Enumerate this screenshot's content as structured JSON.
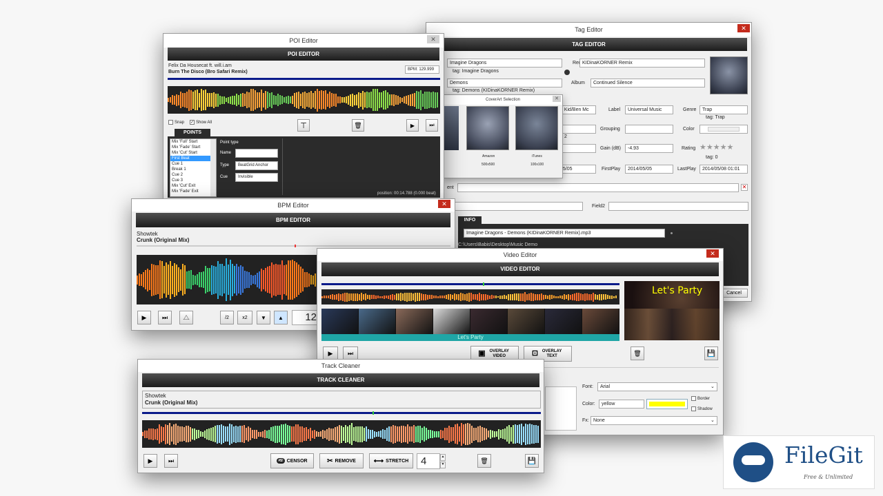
{
  "tag_editor": {
    "title": "Tag Editor",
    "header": "TAG EDITOR",
    "close": "✕",
    "artist": "Imagine Dragons",
    "artist_tag": "tag: Imagine Dragons",
    "title_val": "Demons",
    "title_tag": "tag: Demons (KIDinaKORNER Remix)",
    "remix_label": "Remix",
    "remix": "KIDinaKORNER Remix",
    "album_label": "Album",
    "album": "Continued Silence",
    "composer_partial": "a Kid/Ben Mc",
    "label_label": "Label",
    "label_val": "Universal Music",
    "genre_label": "Genre",
    "genre": "Trap",
    "genre_tag": "tag: Trap",
    "grouping_label": "Grouping",
    "color_label": "Color",
    "track_partial": "2",
    "gain_label": "Gain (dB)",
    "gain": "-4.93",
    "rating_label": "Rating",
    "rating_tag": "tag: 0",
    "date_partial": "05/05",
    "firstplay_label": "FirstPlay",
    "firstplay": "2014/05/05",
    "lastplay_label": "LastPlay",
    "lastplay": "2014/05/08 01:01",
    "comment_partial": "ent",
    "field2_label": "Field2",
    "info_tab": "INFO",
    "filename": "Imagine Dragons - Demons (KIDinaKORNER Remix).mp3",
    "path": "C:\\Users\\Babis\\Desktop\\Music Demo",
    "cancel": "Cancel"
  },
  "coverart": {
    "title": "CoverArt Selection",
    "close": "✕",
    "items": [
      {
        "src": "Amazon",
        "size": "500x500"
      },
      {
        "src": "iTunes",
        "size": "100x100"
      }
    ]
  },
  "poi_editor": {
    "title": "POI Editor",
    "header": "POI EDITOR",
    "close": "✕",
    "artist": "Felix Da Housecat ft. will.i.am",
    "track": "Burn The Disco (Bro Safari Remix)",
    "bpm": "BPM: 129.999",
    "snap": "Snap",
    "show_all": "Show All",
    "points_tab": "POINTS",
    "points": [
      "Mix 'Full' Start",
      "Mix 'Fade' Start",
      "Mix 'Cut' Start",
      "First Beat",
      "Cue 1",
      "Break 1",
      "Cue 2",
      "Cue 3",
      "Mix 'Cut' Exit",
      "Mix 'Fade' Exit"
    ],
    "point_type_label": "Point type",
    "name_label": "Name",
    "type_label": "Type",
    "type_val": "BeatGrid Anchor",
    "cue_label": "Cue",
    "cue_val": "Invisible",
    "position": "position: 00:14.788 (0.000 beat)"
  },
  "bpm_editor": {
    "title": "BPM Editor",
    "header": "BPM EDITOR",
    "close": "✕",
    "artist": "Showtek",
    "track": "Crunk (Original Mix)",
    "half": "/2",
    "double": "x2",
    "value": "12"
  },
  "video_editor": {
    "title": "Video Editor",
    "header": "VIDEO EDITOR",
    "close": "✕",
    "overlay_video": "OVERLAY VIDEO",
    "overlay_text": "OVERLAY TEXT",
    "strip_text": "Let's Party",
    "preview_text": "Let's Party",
    "font_label": "Font:",
    "font_val": "Arial",
    "color_label": "Color:",
    "color_val": "yellow",
    "color_swatch": "#ffff00",
    "border": "Border",
    "shadow": "Shadow",
    "fx_label": "Fx:",
    "fx_val": "None"
  },
  "track_cleaner": {
    "title": "Track Cleaner",
    "header": "TRACK CLEANER",
    "artist": "Showtek",
    "track": "Crunk (Original Mix)",
    "censor": "CENSOR",
    "remove": "REMOVE",
    "stretch": "STRETCH",
    "stretch_val": "4"
  },
  "watermark": {
    "brand": "FileGit",
    "tagline": "Free & Unlimited"
  }
}
